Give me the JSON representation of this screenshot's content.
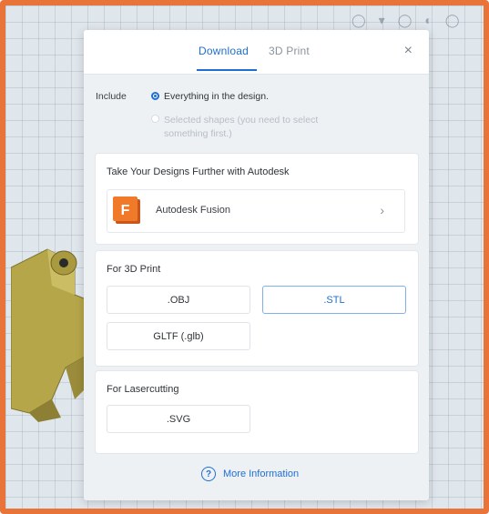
{
  "tabs": {
    "download": "Download",
    "print3d": "3D Print"
  },
  "close_icon": "×",
  "include": {
    "label": "Include",
    "option_all": "Everything in the design.",
    "option_selected": "Selected shapes (you need to select something first.)",
    "selected": "all"
  },
  "autodesk": {
    "title": "Take Your Designs Further with Autodesk",
    "fusion_letter": "F",
    "fusion_label": "Autodesk Fusion",
    "chevron": "›"
  },
  "print3d": {
    "title": "For 3D Print",
    "obj": ".OBJ",
    "stl": ".STL",
    "gltf": "GLTF (.glb)"
  },
  "laser": {
    "title": "For Lasercutting",
    "svg": ".SVG"
  },
  "more_info": {
    "icon": "?",
    "label": "More Information"
  },
  "colors": {
    "accent": "#1f6fd1",
    "frame": "#e8743a",
    "shape": "#b6a64a",
    "fusion": "#f07a2a"
  },
  "icons": [
    "close-icon",
    "chevron-right-icon",
    "help-circle-icon",
    "fusion-logo-icon"
  ]
}
